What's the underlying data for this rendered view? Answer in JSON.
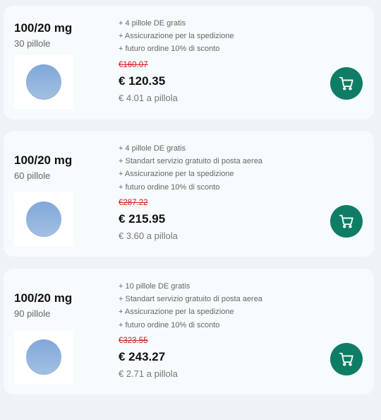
{
  "offers": [
    {
      "dose": "100/20 mg",
      "count": "30 pillole",
      "features": [
        "+ 4 pillole DE gratis",
        "+ Assicurazione per la spedizione",
        "+ futuro ordine 10% di sconto"
      ],
      "old_price": "€160.07",
      "price": "€ 120.35",
      "per_pill": "€ 4.01 a pillola",
      "cart_icon": "shopping-cart-icon"
    },
    {
      "dose": "100/20 mg",
      "count": "60 pillole",
      "features": [
        "+ 4 pillole DE gratis",
        "+ Standart servizio gratuito di posta aerea",
        "+ Assicurazione per la spedizione",
        "+ futuro ordine 10% di sconto"
      ],
      "old_price": "€287.22",
      "price": "€ 215.95",
      "per_pill": "€ 3.60 a pillola",
      "cart_icon": "shopping-cart-icon"
    },
    {
      "dose": "100/20 mg",
      "count": "90 pillole",
      "features": [
        "+ 10 pillole DE gratis",
        "+ Standart servizio gratuito di posta aerea",
        "+ Assicurazione per la spedizione",
        "+ futuro ordine 10% di sconto"
      ],
      "old_price": "€323.55",
      "price": "€ 243.27",
      "per_pill": "€ 2.71 a pillola",
      "cart_icon": "shopping-cart-icon"
    }
  ],
  "colors": {
    "accent": "#0f7d65",
    "old_price": "#d21f1f",
    "card_bg": "#f6fbfe",
    "page_bg": "#eef3f8",
    "pill": "#8fb3de"
  }
}
